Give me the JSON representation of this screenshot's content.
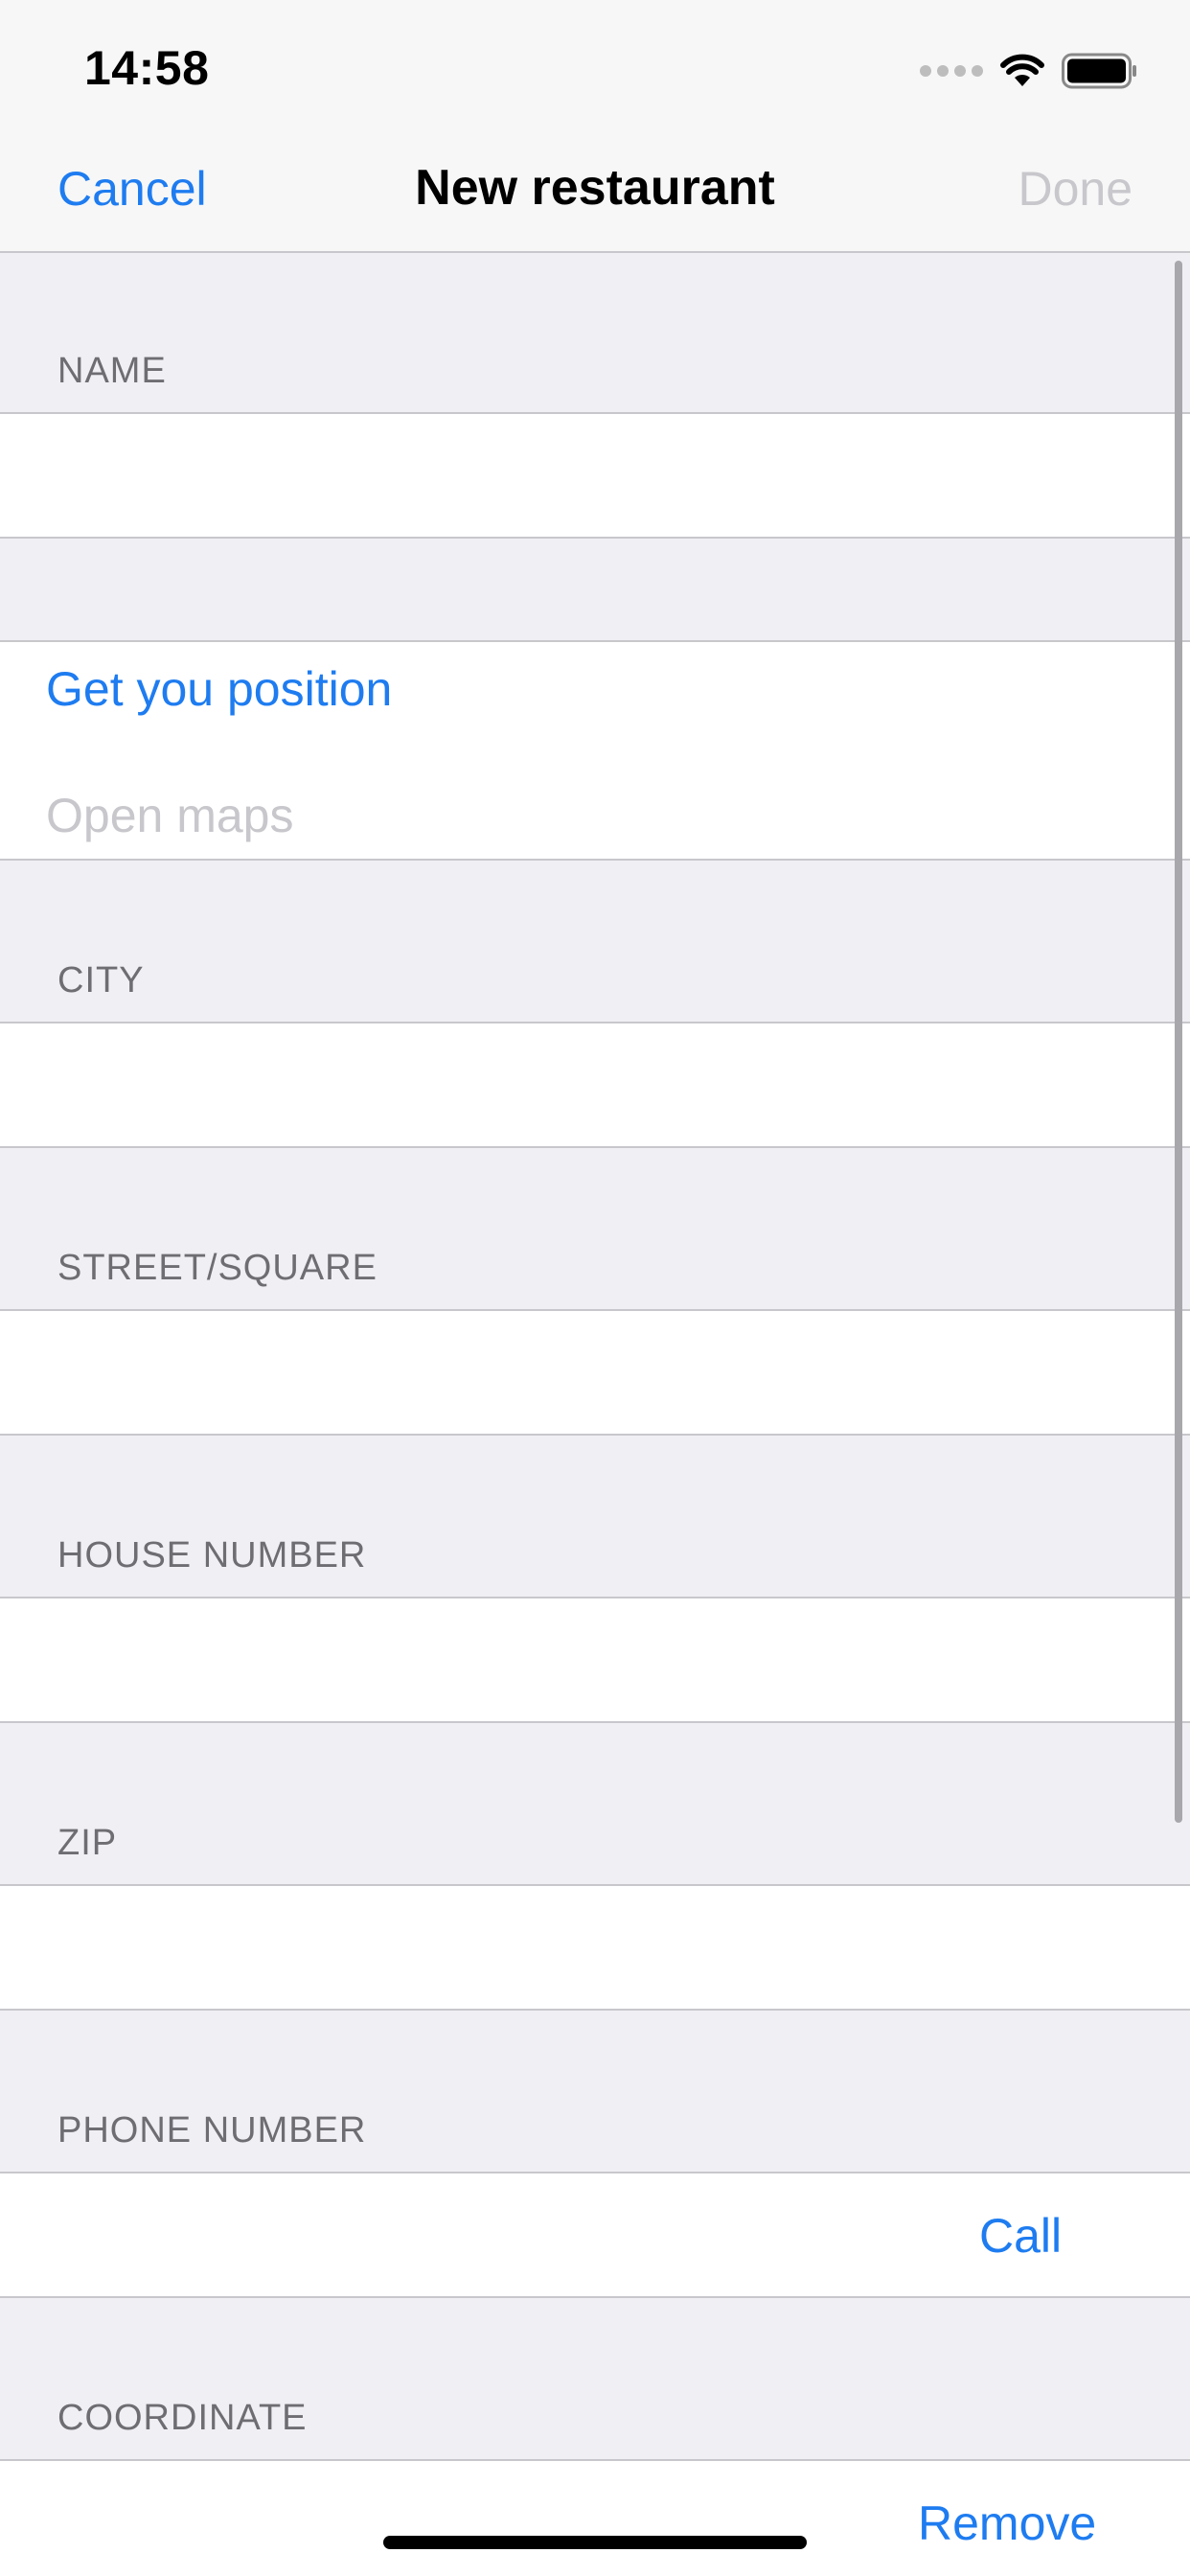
{
  "status_bar": {
    "time": "14:58",
    "icons": [
      "signal-icon",
      "wifi-icon",
      "battery-icon"
    ]
  },
  "nav": {
    "cancel_label": "Cancel",
    "title": "New restaurant",
    "done_label": "Done"
  },
  "colors": {
    "accent": "#1E7CF0",
    "disabled": "#C7C7CC",
    "header_text": "#6D6D72",
    "background": "#EFEFF4"
  },
  "form": {
    "name_header": "NAME",
    "name_value": "",
    "position_link": "Get you position",
    "maps_placeholder": "Open maps",
    "city_header": "CITY",
    "city_value": "",
    "street_header": "STREET/SQUARE",
    "street_value": "",
    "house_header": "HOUSE NUMBER",
    "house_value": "",
    "zip_header": "ZIP",
    "zip_value": "",
    "phone_header": "PHONE NUMBER",
    "phone_value": "",
    "call_label": "Call",
    "coordinate_header": "COORDINATE",
    "remove_label": "Remove"
  }
}
